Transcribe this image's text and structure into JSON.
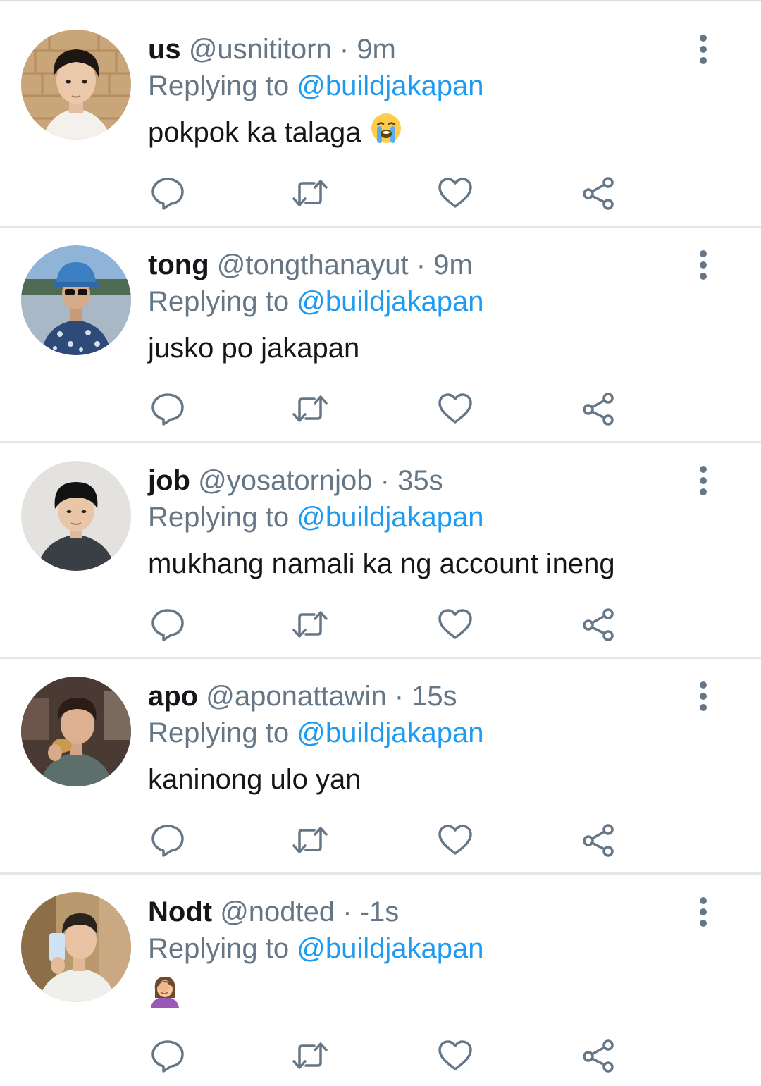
{
  "colors": {
    "name": "#14171a",
    "secondary": "#657786",
    "mention": "#1d9bf0",
    "icon": "#657786",
    "divider": "#e3e7eb"
  },
  "tweets": [
    {
      "name": "us",
      "handle": "@usnititorn",
      "sep": "·",
      "time": "9m",
      "replying_prefix": "Replying to",
      "replying_to": "@buildjakapan",
      "text": "pokpok ka talaga",
      "emoji": "loudly-crying-face"
    },
    {
      "name": "tong",
      "handle": "@tongthanayut",
      "sep": "·",
      "time": "9m",
      "replying_prefix": "Replying to",
      "replying_to": "@buildjakapan",
      "text": "jusko po jakapan",
      "emoji": ""
    },
    {
      "name": "job",
      "handle": "@yosatornjob",
      "sep": "·",
      "time": "35s",
      "replying_prefix": "Replying to",
      "replying_to": "@buildjakapan",
      "text": "mukhang namali ka ng account ineng",
      "emoji": ""
    },
    {
      "name": "apo",
      "handle": "@aponattawin",
      "sep": "·",
      "time": "15s",
      "replying_prefix": "Replying to",
      "replying_to": "@buildjakapan",
      "text": "kaninong ulo yan",
      "emoji": ""
    },
    {
      "name": "Nodt",
      "handle": "@nodted",
      "sep": "·",
      "time": "-1s",
      "replying_prefix": "Replying to",
      "replying_to": "@buildjakapan",
      "text": "",
      "emoji": "woman-facepalming"
    }
  ]
}
